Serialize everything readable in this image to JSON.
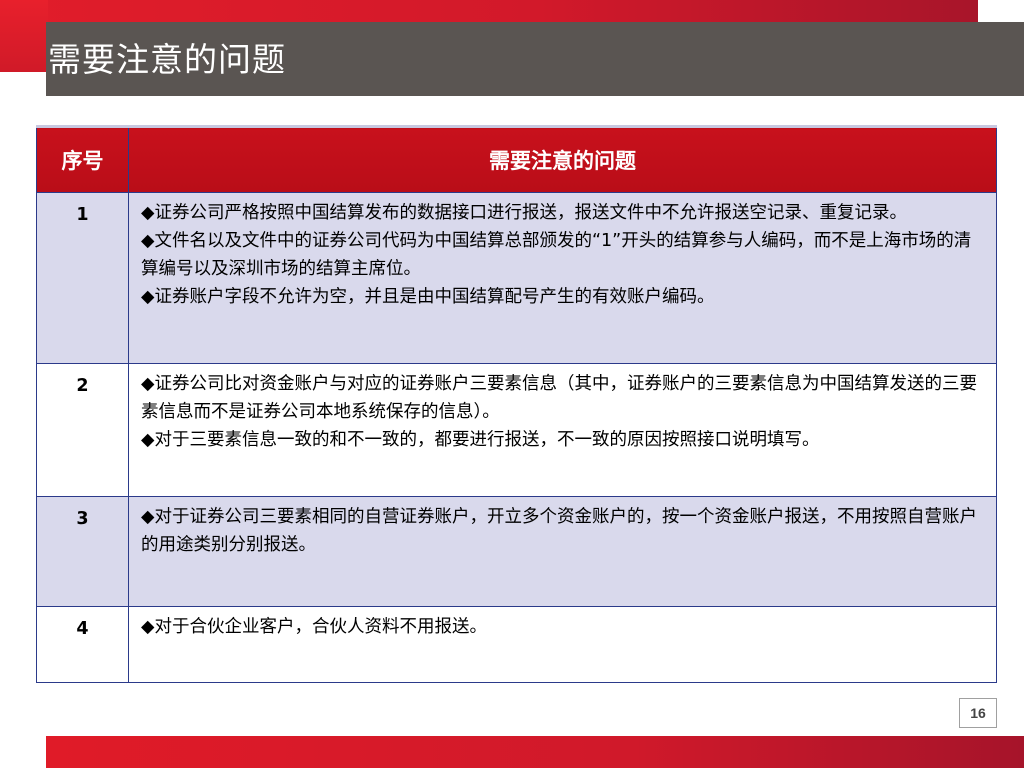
{
  "slide": {
    "title": "需要注意的问题",
    "page_number": "16"
  },
  "table": {
    "headers": [
      "序号",
      "需要注意的问题"
    ],
    "rows": [
      {
        "num": "1",
        "items": [
          "◆证券公司严格按照中国结算发布的数据接口进行报送，报送文件中不允许报送空记录、重复记录。",
          "◆文件名以及文件中的证券公司代码为中国结算总部颁发的“1”开头的结算参与人编码，而不是上海市场的清算编号以及深圳市场的结算主席位。",
          "◆证券账户字段不允许为空，并且是由中国结算配号产生的有效账户编码。"
        ]
      },
      {
        "num": "2",
        "items": [
          "◆证券公司比对资金账户与对应的证券账户三要素信息（其中，证券账户的三要素信息为中国结算发送的三要素信息而不是证券公司本地系统保存的信息）。",
          "◆对于三要素信息一致的和不一致的，都要进行报送，不一致的原因按照接口说明填写。"
        ]
      },
      {
        "num": "3",
        "items": [
          "◆对于证券公司三要素相同的自营证券账户，开立多个资金账户的，按一个资金账户报送，不用按照自营账户的用途类别分别报送。"
        ]
      },
      {
        "num": "4",
        "items": [
          "◆对于合伙企业客户，合伙人资料不用报送。"
        ]
      }
    ]
  }
}
